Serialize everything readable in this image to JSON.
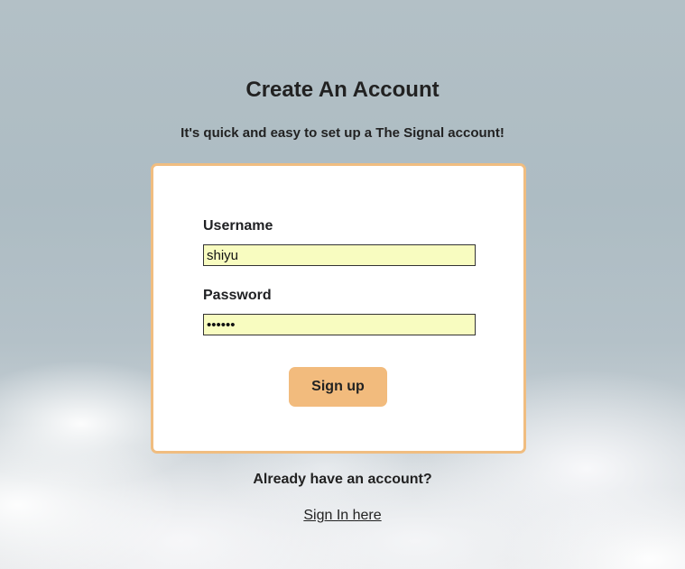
{
  "header": {
    "title": "Create An Account",
    "subtitle": "It's quick and easy to set up a The Signal account!"
  },
  "form": {
    "username_label": "Username",
    "username_value": "shiyu",
    "password_label": "Password",
    "password_value": "shiyu1",
    "submit_label": "Sign up"
  },
  "footer": {
    "prompt": "Already have an account?",
    "signin_link": "Sign In here"
  },
  "colors": {
    "card_border": "#f0bd80",
    "button_bg": "#f2bb7d",
    "input_bg": "#f8fcc0"
  }
}
